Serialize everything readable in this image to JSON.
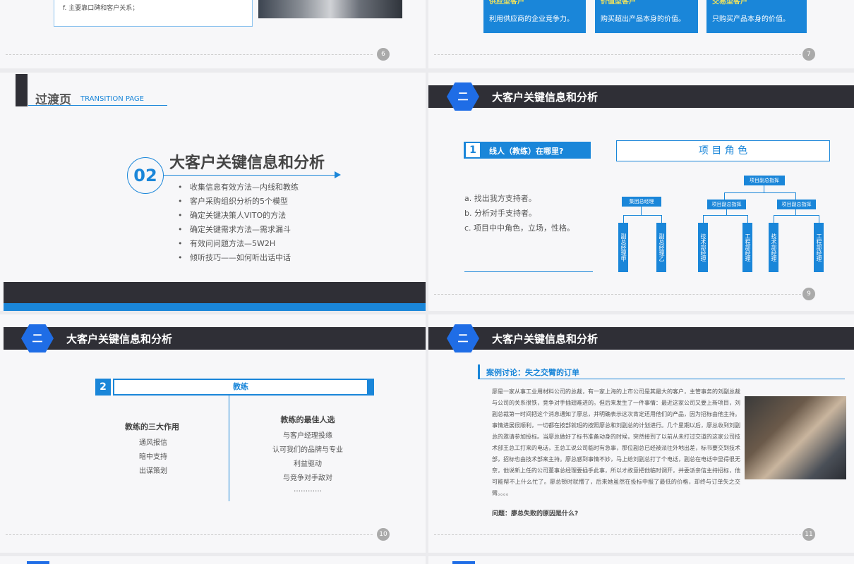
{
  "slide6": {
    "bullet_f": "f. 主要靠口碑和客户关系；",
    "page": "6"
  },
  "slide7": {
    "cards": [
      {
        "title": "供应型客户",
        "desc": "利用供应商的企业竞争力。"
      },
      {
        "title": "价值型客户",
        "desc": "购买超出产品本身的价值。"
      },
      {
        "title": "交易型客户",
        "desc": "只购买产品本身的价值。"
      }
    ],
    "page": "7"
  },
  "slide8": {
    "title_cn": "过渡页",
    "title_en": "TRANSITION PAGE",
    "number": "02",
    "heading": "大客户关键信息和分析",
    "items": [
      "收集信息有效方法—内线和教练",
      "客户采购组织分析的5个模型",
      "确定关键决策人VITO的方法",
      "确定关键需求方法—需求漏斗",
      "有效问问题方法—5W2H",
      "倾听技巧——如何听出话中话"
    ]
  },
  "slide9": {
    "hex": "二",
    "title": "大客户关键信息和分析",
    "num": "1",
    "question": "线人（教练）在哪里?",
    "role_title": "项 目 角 色",
    "points": [
      "a. 找出我方支持者。",
      "b. 分析对手支持者。",
      "c. 项目中中角色，立场，性格。"
    ],
    "org": {
      "top": "项目副总指挥",
      "left_head": "集团总经理",
      "mid1": "项目副总指挥",
      "mid2": "项目副总指挥",
      "leaves": [
        "副总经理甲",
        "副总经理乙",
        "技术部经理",
        "工程部经理",
        "技术部经理",
        "工程部经理"
      ]
    },
    "page": "9"
  },
  "slide10": {
    "hex": "二",
    "title": "大客户关键信息和分析",
    "num": "2",
    "bar_label": "教练",
    "left_title": "教练的三大作用",
    "left_items": [
      "通风报信",
      "暗中支持",
      "出谋策划"
    ],
    "right_title": "教练的最佳人选",
    "right_items": [
      "与客户经理投缘",
      "认可我们的品牌与专业",
      "利益驱动",
      "与竞争对手敌对",
      "…………"
    ],
    "page": "10"
  },
  "slide11": {
    "hex": "二",
    "title": "大客户关键信息和分析",
    "case_title": "案例讨论：失之交臂的订单",
    "body": "廖是一家从事工业用材料公司的总裁，有一家上海的上市公司是其最大的客户，主管事务的刘副总裁与公司的关系很铁，竞争对手插翅难进的。但后来发生了一件事情：最近这家公司又要上新项目，刘副总裁第一时间把这个消息通知了廖总，并明确表示这次肯定还用他们的产品，因为招标由他主持。事情进展很顺利，一切都在按部就班的按照廖总和刘副总的计划进行。几个星期以后，廖总收到刘副总的邀请参加投标。当廖总做好了标书准备动身的时候，突然接到了以前从未打过交道的这家公司技术部王总工打来的电话，王总工说公司临时有急事，那位副总已经被派往外地出差，标书要交到技术部，招标也由技术部来主持。廖总感到事情不妙，马上给刘副总打了个电话，副总在电话中显得很无奈，他说新上任的公司董事总经理要插手此事，所以才故意把他临时调开，并委派亲信主持招标，他可能帮不上什么忙了。廖总顿时就懵了，后来她虽然在投标中报了最低的价格，却终与订单失之交臂。。。。",
    "question": "问题：廖总失败的原因是什么?",
    "page": "11"
  },
  "colors": {
    "blue": "#1a86d9",
    "dark": "#2f2f36",
    "hex": "#1f6de6"
  }
}
